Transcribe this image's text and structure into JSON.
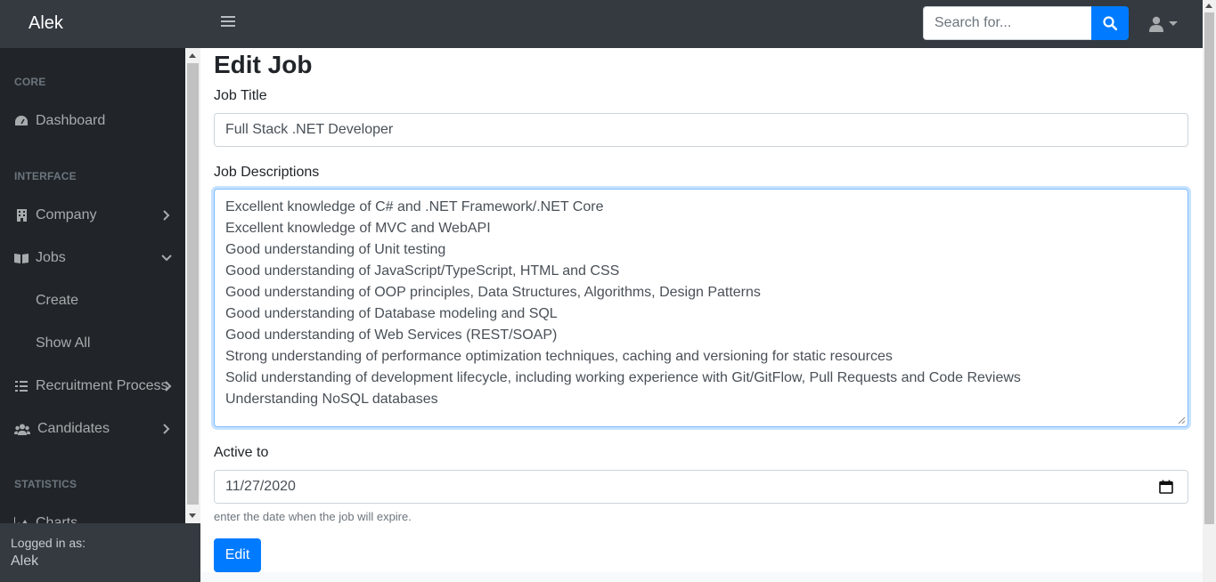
{
  "topbar": {
    "brand": "Alek",
    "search_placeholder": "Search for..."
  },
  "sidebar": {
    "headings": {
      "core": "CORE",
      "interface": "INTERFACE",
      "statistics": "STATISTICS"
    },
    "items": {
      "dashboard": "Dashboard",
      "company": "Company",
      "jobs": "Jobs",
      "recruitment": "Recruitment Process",
      "candidates": "Candidates",
      "charts": "Charts"
    },
    "jobs_sub": {
      "create": "Create",
      "show_all": "Show All"
    },
    "footer": {
      "logged_in_as": "Logged in as:",
      "user": "Alek"
    }
  },
  "main": {
    "title": "Edit Job",
    "job_title_label": "Job Title",
    "job_title_value": "Full Stack .NET Developer",
    "descriptions_label": "Job Descriptions",
    "descriptions": [
      "Excellent knowledge of C# and .NET Framework/.NET Core",
      "Excellent knowledge of MVC and WebAPI",
      "Good understanding of Unit testing",
      "Good understanding of JavaScript/TypeScript, HTML and CSS",
      "Good understanding of OOP principles, Data Structures, Algorithms, Design Patterns",
      "Good understanding of Database modeling and SQL",
      "Good understanding of Web Services (REST/SOAP)",
      "Strong understanding of performance optimization techniques, caching and versioning for static resources",
      "Solid understanding of development lifecycle, including working experience with Git/GitFlow, Pull Requests and Code Reviews",
      "Understanding NoSQL databases"
    ],
    "active_to_label": "Active to",
    "active_to_value": "11/27/2020",
    "help_text": "enter the date when the job will expire.",
    "submit_label": "Edit"
  }
}
